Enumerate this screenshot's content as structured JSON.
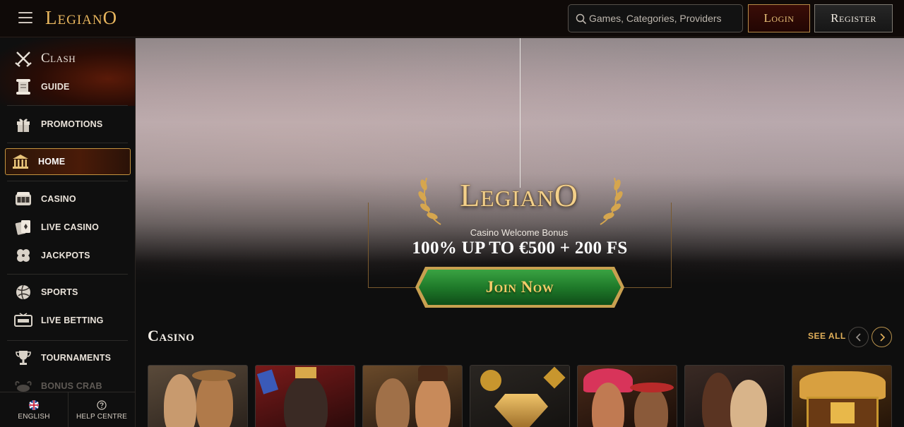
{
  "header": {
    "brand": "LegianO",
    "search_placeholder": "Games, Categories, Providers",
    "login_label": "Login",
    "register_label": "Register"
  },
  "sidebar": {
    "items": [
      {
        "label": "Clash",
        "icon": "crossed-swords-icon"
      },
      {
        "label": "GUIDE",
        "icon": "scroll-icon"
      },
      {
        "label": "PROMOTIONS",
        "icon": "gift-icon"
      },
      {
        "label": "HOME",
        "icon": "temple-icon",
        "active": true
      },
      {
        "label": "CASINO",
        "icon": "slot-machine-icon"
      },
      {
        "label": "LIVE CASINO",
        "icon": "playing-cards-icon"
      },
      {
        "label": "JACKPOTS",
        "icon": "clover-icon"
      },
      {
        "label": "SPORTS",
        "icon": "sports-ball-icon"
      },
      {
        "label": "LIVE BETTING",
        "icon": "live-screen-icon"
      },
      {
        "label": "TOURNAMENTS",
        "icon": "trophy-icon"
      },
      {
        "label": "BONUS CRAB",
        "icon": "crab-icon"
      }
    ],
    "footer": {
      "language_label": "ENGLISH",
      "help_label": "HELP CENTRE"
    }
  },
  "hero": {
    "logo_text": "LegianO",
    "subtitle": "Casino Welcome Bonus",
    "bonus": "100% UP TO €500 + 200 FS",
    "cta_label": "Join Now"
  },
  "casino_section": {
    "title": "Casino",
    "see_all_label": "SEE ALL",
    "cards": [
      {
        "theme": "amazon-explorers"
      },
      {
        "theme": "king-throne"
      },
      {
        "theme": "pirate-bandits"
      },
      {
        "theme": "golden-diamond"
      },
      {
        "theme": "aztec-fiesta"
      },
      {
        "theme": "glamour-ladies"
      },
      {
        "theme": "treasure-chest"
      }
    ]
  },
  "colors": {
    "accent_gold": "#e2b05a",
    "join_green": "#1f7a2a",
    "login_bg": "#2a0904",
    "background": "#0e0e0e"
  }
}
